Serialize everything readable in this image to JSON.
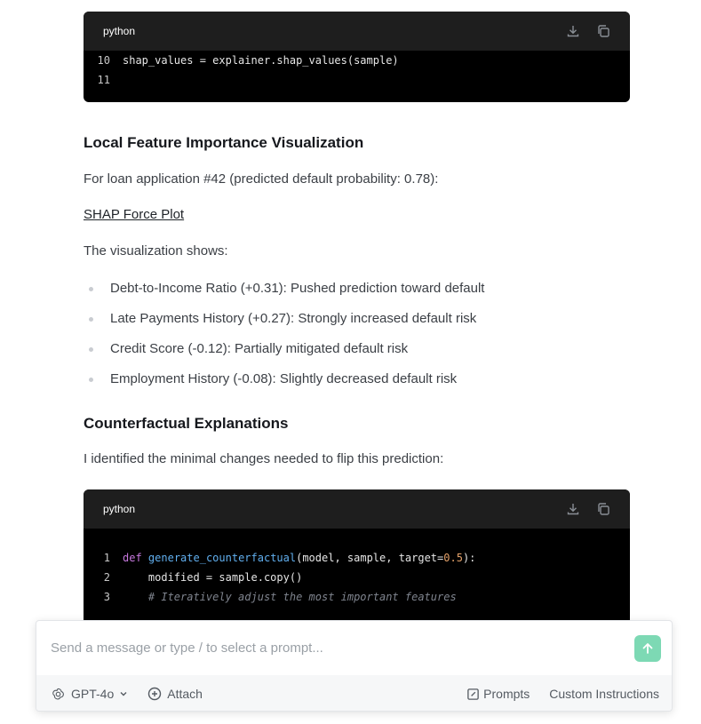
{
  "code_block_1": {
    "language": "python",
    "lines": [
      {
        "num": "10",
        "text": "shap_values = explainer.shap_values(sample)"
      },
      {
        "num": "11",
        "text": ""
      }
    ]
  },
  "section_local": {
    "heading": "Local Feature Importance Visualization",
    "intro": "For loan application #42 (predicted default probability: 0.78):",
    "link": "SHAP Force Plot",
    "shows": "The visualization shows:",
    "bullets": [
      "Debt-to-Income Ratio (+0.31): Pushed prediction toward default",
      "Late Payments History (+0.27): Strongly increased default risk",
      "Credit Score (-0.12): Partially mitigated default risk",
      "Employment History (-0.08): Slightly decreased default risk"
    ]
  },
  "section_counterfactual": {
    "heading": "Counterfactual Explanations",
    "intro": "I identified the minimal changes needed to flip this prediction:"
  },
  "code_block_2": {
    "language": "python",
    "line1": {
      "num": "1",
      "kw": "def",
      "fn": "generate_counterfactual",
      "args": "(model, sample, target=",
      "num_val": "0.5",
      "end": "):"
    },
    "line2": {
      "num": "2",
      "text": "    modified = sample.copy()"
    },
    "line3": {
      "num": "3",
      "text": "    # Iteratively adjust the most important features"
    }
  },
  "composer": {
    "placeholder": "Send a message or type / to select a prompt...",
    "model": "GPT-4o",
    "attach": "Attach",
    "prompts": "Prompts",
    "custom_instructions": "Custom Instructions",
    "send_color": "#7dd9b4"
  }
}
